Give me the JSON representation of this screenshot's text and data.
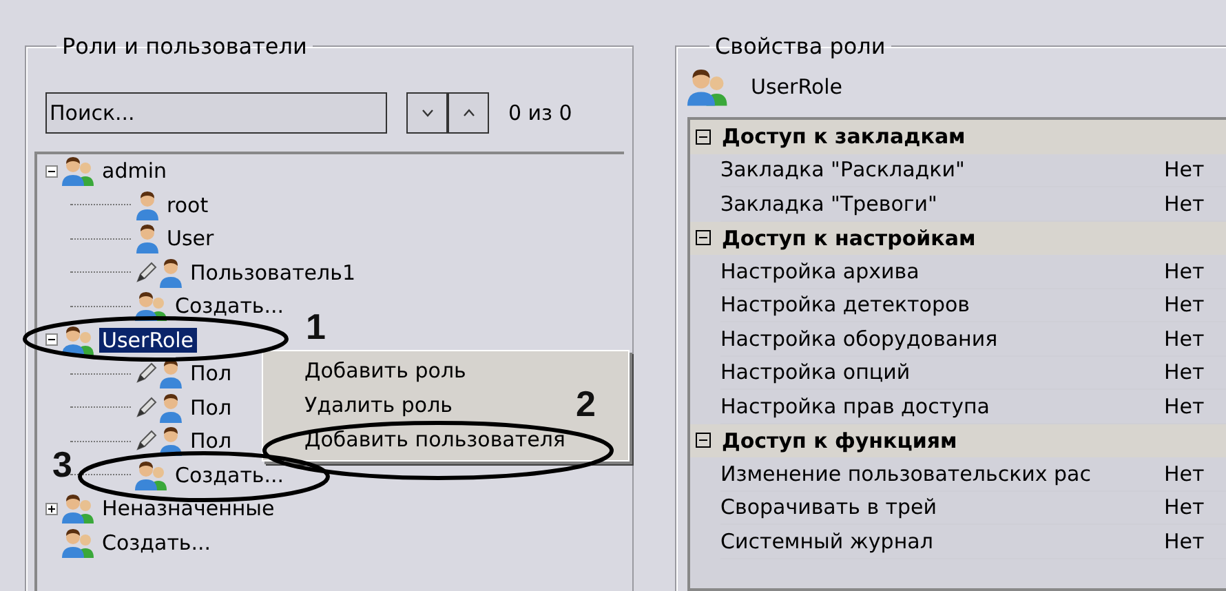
{
  "left_panel": {
    "title": "Роли и пользователи",
    "search": {
      "placeholder": "Поиск..."
    },
    "counter": "0 из 0",
    "tree": [
      {
        "kind": "role",
        "label": "admin",
        "expanded": true,
        "selected": false,
        "children": [
          {
            "kind": "user",
            "label": "root",
            "edited": false,
            "selected": false
          },
          {
            "kind": "user",
            "label": "User",
            "edited": false,
            "selected": false
          },
          {
            "kind": "user",
            "label": "Пользователь1",
            "edited": true,
            "selected": false
          },
          {
            "kind": "create",
            "label": "Создать...",
            "selected": false
          }
        ]
      },
      {
        "kind": "role",
        "label": "UserRole",
        "expanded": true,
        "selected": true,
        "children": [
          {
            "kind": "user",
            "label": "Пол",
            "edited": true,
            "selected": false
          },
          {
            "kind": "user",
            "label": "Пол",
            "edited": true,
            "selected": false
          },
          {
            "kind": "user",
            "label": "Пол",
            "edited": true,
            "selected": false
          },
          {
            "kind": "create",
            "label": "Создать...",
            "selected": false
          }
        ]
      },
      {
        "kind": "role",
        "label": "Неназначенные",
        "expanded": false,
        "selected": false
      },
      {
        "kind": "create",
        "label": "Создать...",
        "selected": false
      }
    ],
    "context_menu": [
      {
        "label": "Добавить роль"
      },
      {
        "label": "Удалить роль"
      },
      {
        "label": "Добавить пользователя"
      }
    ],
    "annotations": [
      {
        "label": "1"
      },
      {
        "label": "2"
      },
      {
        "label": "3"
      }
    ]
  },
  "right_panel": {
    "title": "Свойства роли",
    "role_name": "UserRole",
    "sections": [
      {
        "title": "Доступ к закладкам",
        "expanded": true,
        "rows": [
          {
            "name": "Закладка \"Раскладки\"",
            "value": "Нет"
          },
          {
            "name": "Закладка \"Тревоги\"",
            "value": "Нет"
          }
        ]
      },
      {
        "title": "Доступ к настройкам",
        "expanded": true,
        "rows": [
          {
            "name": "Настройка архива",
            "value": "Нет"
          },
          {
            "name": "Настройка детекторов",
            "value": "Нет"
          },
          {
            "name": "Настройка оборудования",
            "value": "Нет"
          },
          {
            "name": "Настройка опций",
            "value": "Нет"
          },
          {
            "name": "Настройка прав доступа",
            "value": "Нет"
          }
        ]
      },
      {
        "title": "Доступ к функциям",
        "expanded": true,
        "rows": [
          {
            "name": "Изменение пользовательских рас",
            "value": "Нет"
          },
          {
            "name": "Сворачивать в трей",
            "value": "Нет"
          },
          {
            "name": "Системный журнал",
            "value": "Нет"
          }
        ]
      }
    ]
  }
}
